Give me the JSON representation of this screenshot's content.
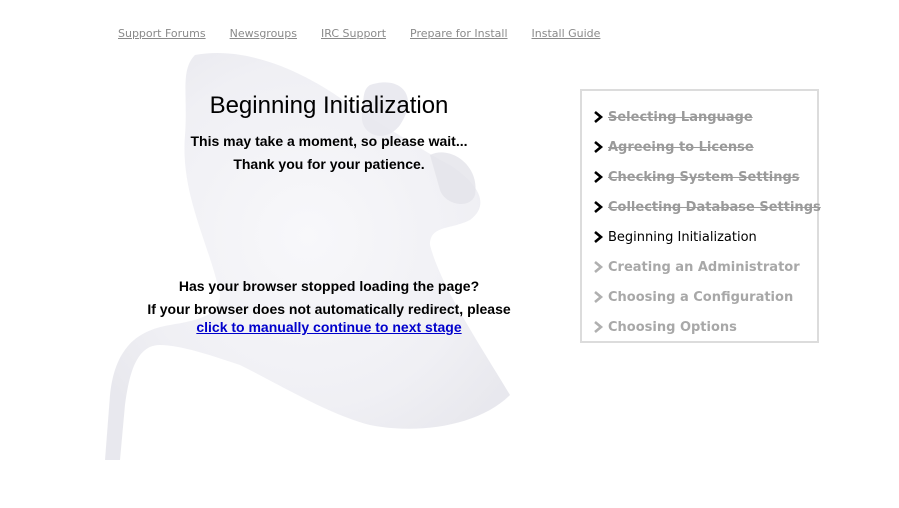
{
  "nav": {
    "links": [
      {
        "label": "Support Forums"
      },
      {
        "label": "Newsgroups"
      },
      {
        "label": "IRC Support"
      },
      {
        "label": "Prepare for Install"
      },
      {
        "label": "Install Guide"
      }
    ]
  },
  "main": {
    "title": "Beginning Initialization",
    "wait_text": "This may take a moment, so please wait...",
    "patience_text": "Thank you for your patience.",
    "question_text": "Has your browser stopped loading the page?",
    "redirect_text": "If your browser does not automatically redirect, please",
    "continue_link": "click to manually continue to next stage"
  },
  "steps": [
    {
      "label": "Selecting Language",
      "state": "done"
    },
    {
      "label": "Agreeing to License",
      "state": "done"
    },
    {
      "label": "Checking System Settings",
      "state": "done"
    },
    {
      "label": "Collecting Database Settings",
      "state": "done"
    },
    {
      "label": "Beginning Initialization",
      "state": "current"
    },
    {
      "label": "Creating an Administrator",
      "state": "pending"
    },
    {
      "label": "Choosing a Configuration",
      "state": "pending"
    },
    {
      "label": "Choosing Options",
      "state": "pending"
    }
  ],
  "colors": {
    "link_blue": "#0000cc",
    "nav_gray": "#8a8a8a",
    "done_gray": "#9a9a9a",
    "pending_gray": "#a8a8a8",
    "panel_border": "#dcdcdc"
  },
  "icons": {
    "step_marker": "chevron-right-icon",
    "background": "watermark-logo"
  }
}
